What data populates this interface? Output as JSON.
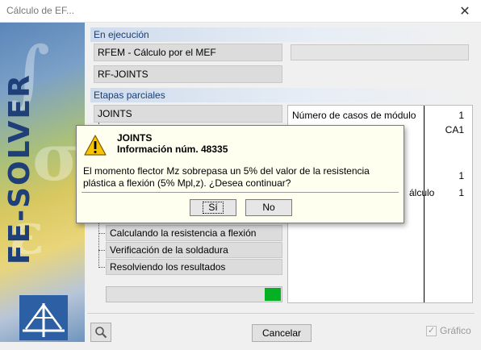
{
  "window": {
    "title": "Cálculo de EF...",
    "close_glyph": "✕"
  },
  "banner": {
    "text": "FE-SOLVER",
    "logo_icon": "dlubal-logo-icon"
  },
  "en_ejecucion": {
    "header": "En ejecución",
    "program": "RFEM - Cálculo por el MEF",
    "module": "RF-JOINTS"
  },
  "etapas": {
    "header": "Etapas parciales",
    "root": "JOINTS",
    "steps": [
      "Calculando la resistencia a flexión",
      "Verificación de la soldadura",
      "Resolviendo los resultados"
    ],
    "progress_fraction": 0.09
  },
  "info_grid": {
    "rows": [
      {
        "label": "Número de casos de módulo",
        "value": "1"
      },
      {
        "label": "",
        "value": "CA1"
      },
      {
        "label": "",
        "value": "1"
      },
      {
        "label": "álculo",
        "value": "1"
      }
    ]
  },
  "buttons": {
    "cancel": "Cancelar",
    "graphics": "Gráfico"
  },
  "message": {
    "icon": "warning-icon",
    "title": "JOINTS",
    "subtitle": "Información núm. 48335",
    "body": "El momento flector Mz sobrepasa un 5% del valor de la resistencia plástica a flexión (5% Mpl,z). ¿Desea continuar?",
    "yes": "Sí",
    "no": "No"
  },
  "colors": {
    "accent": "#1a3c78",
    "progress": "#06b025",
    "dialog_bg": "#fffff0"
  }
}
